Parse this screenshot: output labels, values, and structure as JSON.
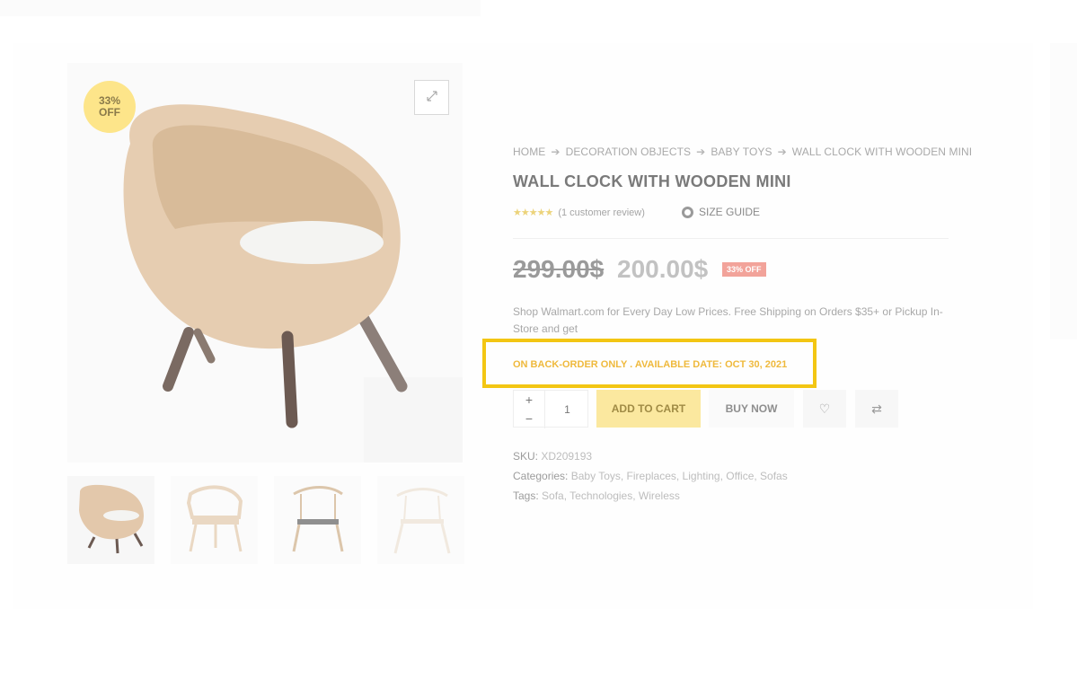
{
  "product": {
    "badge_line1": "33%",
    "badge_line2": "OFF",
    "breadcrumb": [
      "HOME",
      "DECORATION OBJECTS",
      "BABY TOYS",
      "WALL CLOCK WITH WOODEN MINI"
    ],
    "breadcrumb_separator": "➔",
    "title": "WALL CLOCK WITH WOODEN MINI",
    "stars": "★★★★★",
    "rating_text": "(1 customer review)",
    "size_guide": "SIZE GUIDE",
    "old_price": "299.00$",
    "new_price": "200.00$",
    "off_label": "33% OFF",
    "description": "Shop Walmart.com for Every Day Low Prices. Free Shipping on Orders $35+ or Pickup In-Store and get",
    "backorder": "ON BACK-ORDER ONLY . AVAILABLE DATE: OCT 30, 2021"
  },
  "cart": {
    "plus": "+",
    "minus": "−",
    "quantity": "1",
    "add_to_cart": "ADD TO CART",
    "buy_now": "BUY NOW",
    "wishlist_icon": "♡",
    "compare_icon": "⇄"
  },
  "meta": {
    "sku_label": "SKU:",
    "sku_value": "XD209193",
    "categories_label": "Categories:",
    "categories": "Baby Toys, Fireplaces, Lighting, Office, Sofas",
    "tags_label": "Tags:",
    "tags": "Sofa, Technologies, Wireless"
  },
  "icons": {
    "zoom": "expand-icon",
    "size_guide": "ruler-tape-icon",
    "wishlist": "heart-icon",
    "compare": "compare-arrows-icon"
  },
  "colors": {
    "accent_yellow": "#fbe89f",
    "highlight_border": "#f3c613",
    "backorder_text": "#efb93c",
    "off_badge": "#f2a39a"
  }
}
